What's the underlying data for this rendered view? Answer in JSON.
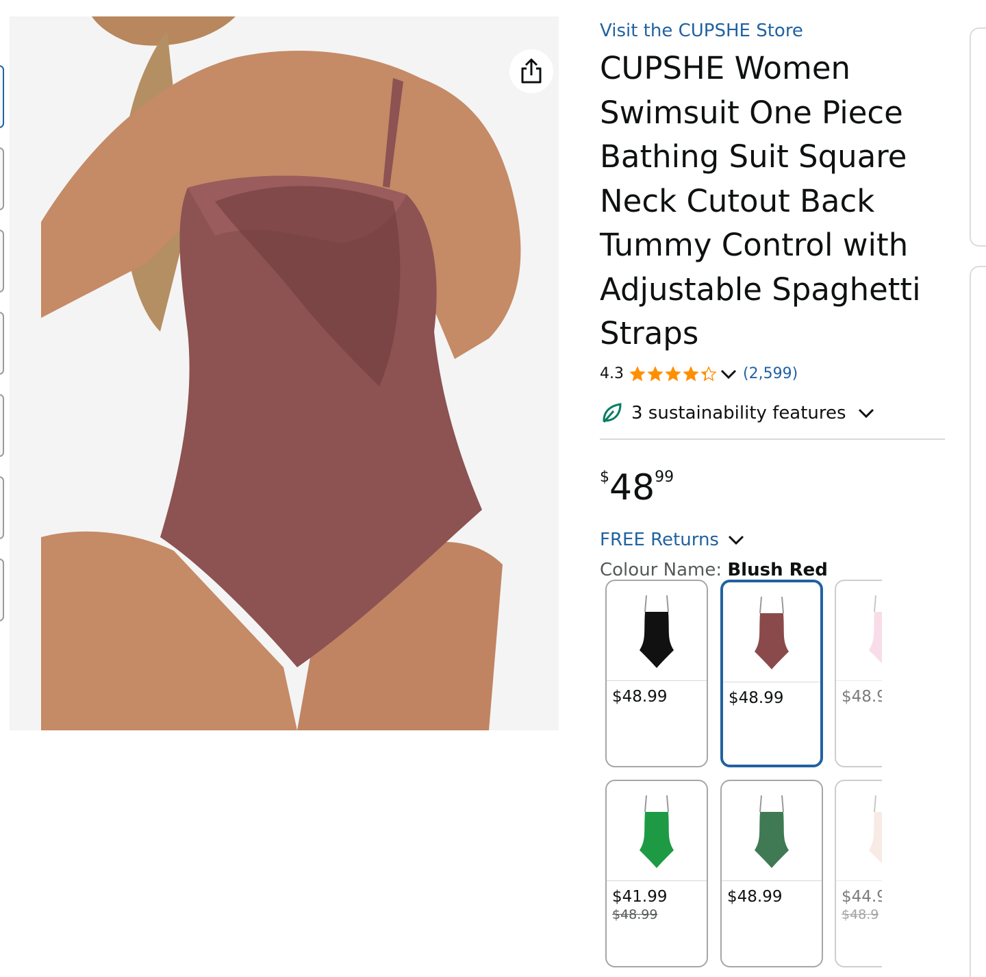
{
  "product": {
    "store_link": "Visit the CUPSHE Store",
    "title": "CUPSHE Women Swimsuit One Piece Bathing Suit Square Neck Cutout Back Tummy Control with Adjustable Spaghetti Straps",
    "rating_value": "4.3",
    "rating_stars": 4.3,
    "rating_count": "(2,599)",
    "sustainability": "3 sustainability features",
    "price": {
      "symbol": "$",
      "whole": "48",
      "fraction": "99"
    },
    "returns": "FREE Returns",
    "colour_label": "Colour Name:",
    "colour_value": "Blush Red"
  },
  "colors": {
    "link": "#2162a1",
    "star": "#ff8f00",
    "leaf": "#067d62",
    "selected_border": "#2162a1"
  },
  "swatches": [
    {
      "price": "$48.99",
      "color": "#111111",
      "selected": false
    },
    {
      "price": "$48.99",
      "color": "#8a4a4b",
      "selected": true
    },
    {
      "price": "$48.9",
      "color": "#f4c2d7",
      "selected": false
    },
    {
      "price": "$41.99",
      "old_price": "$48.99",
      "color": "#1f9a44",
      "selected": false
    },
    {
      "price": "$48.99",
      "color": "#3f7a55",
      "selected": false
    },
    {
      "price": "$44.9",
      "old_price": "$48.9",
      "color": "#f3d9cf",
      "selected": false
    }
  ],
  "icons": {
    "share": "share-icon",
    "sustainability": "leaf-icon",
    "dropdown": "chevron-down-icon",
    "star": "star-icon"
  }
}
